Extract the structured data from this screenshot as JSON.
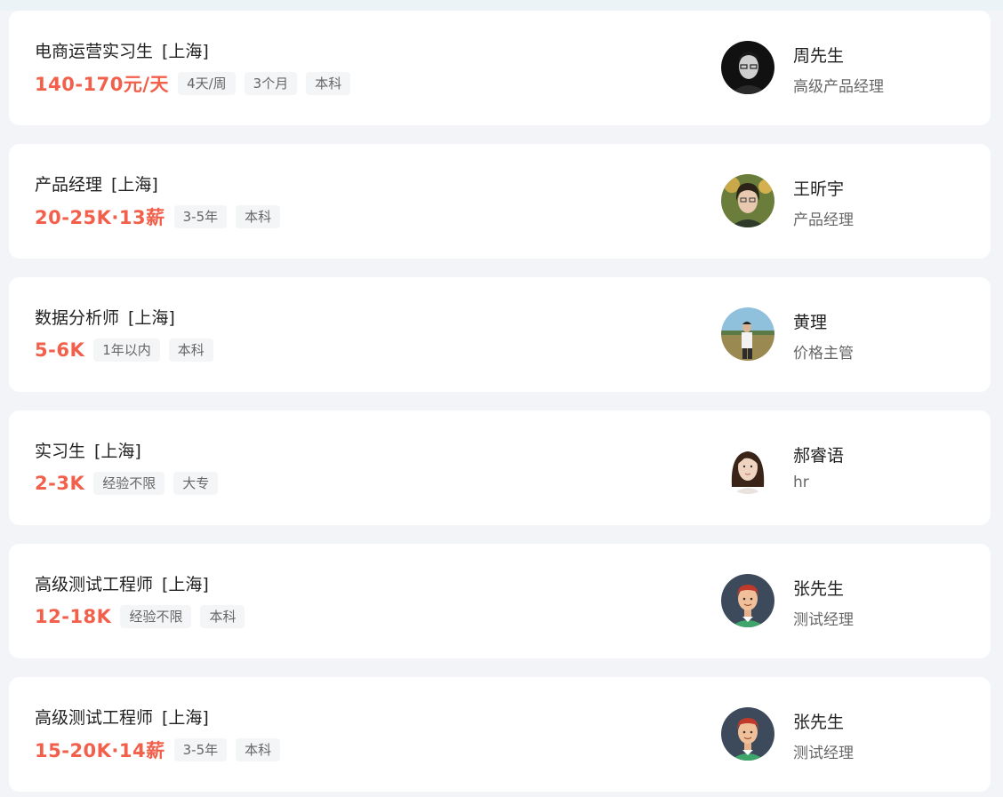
{
  "jobs": [
    {
      "title": "电商运营实习生",
      "city": "[上海]",
      "salary": "140-170元/天",
      "tags": [
        "4天/周",
        "3个月",
        "本科"
      ],
      "recruiter": {
        "name": "周先生",
        "title": "高级产品经理",
        "avatar": "dark-portrait-glasses"
      }
    },
    {
      "title": "产品经理",
      "city": "[上海]",
      "salary": "20-25K·13薪",
      "tags": [
        "3-5年",
        "本科"
      ],
      "recruiter": {
        "name": "王昕宇",
        "title": "产品经理",
        "avatar": "outdoor-portrait"
      }
    },
    {
      "title": "数据分析师",
      "city": "[上海]",
      "salary": "5-6K",
      "tags": [
        "1年以内",
        "本科"
      ],
      "recruiter": {
        "name": "黄理",
        "title": "价格主管",
        "avatar": "landscape-portrait"
      }
    },
    {
      "title": "实习生",
      "city": "[上海]",
      "salary": "2-3K",
      "tags": [
        "经验不限",
        "大专"
      ],
      "recruiter": {
        "name": "郝睿语",
        "title": "hr",
        "avatar": "female-portrait"
      }
    },
    {
      "title": "高级测试工程师",
      "city": "[上海]",
      "salary": "12-18K",
      "tags": [
        "经验不限",
        "本科"
      ],
      "recruiter": {
        "name": "张先生",
        "title": "测试经理",
        "avatar": "cartoon-man-avatar"
      }
    },
    {
      "title": "高级测试工程师",
      "city": "[上海]",
      "salary": "15-20K·14薪",
      "tags": [
        "3-5年",
        "本科"
      ],
      "recruiter": {
        "name": "张先生",
        "title": "测试经理",
        "avatar": "cartoon-man-avatar"
      }
    }
  ],
  "colors": {
    "salary": "#f2604c",
    "background": "#f2f4f7",
    "tag_background": "#f4f5f7"
  }
}
